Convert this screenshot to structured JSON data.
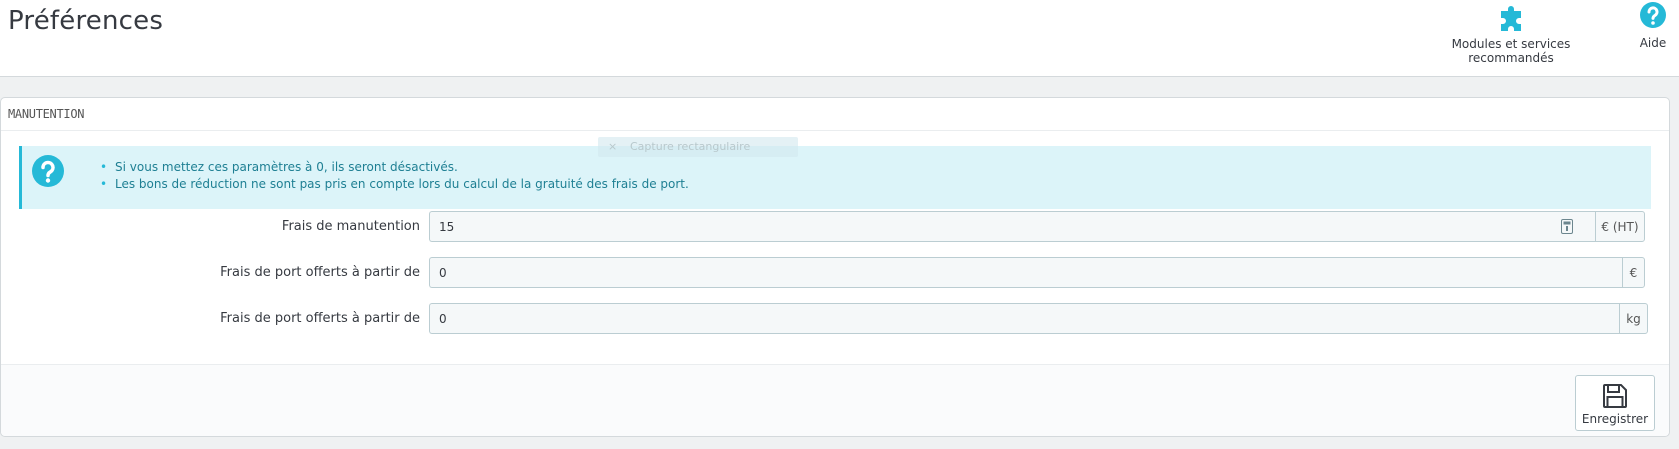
{
  "header": {
    "title": "Préférences",
    "toolbar": {
      "modules_label": "Modules et services recommandés",
      "modules_icon": "puzzle-icon",
      "help_label": "Aide",
      "help_icon": "question-circle-icon"
    }
  },
  "panel": {
    "heading": "MANUTENTION",
    "alert": {
      "icon": "question-circle-icon",
      "items": [
        "Si vous mettez ces paramètres à 0, ils seront désactivés.",
        "Les bons de réduction ne sont pas pris en compte lors du calcul de la gratuité des frais de port."
      ]
    },
    "ghost_overlay": "Capture rectangulaire",
    "fields": [
      {
        "label": "Frais de manutention",
        "value": "15",
        "addon": "€ (HT)"
      },
      {
        "label": "Frais de port offerts à partir de",
        "value": "0",
        "addon": "€"
      },
      {
        "label": "Frais de port offerts à partir de",
        "value": "0",
        "addon": "kg"
      }
    ],
    "footer": {
      "save_label": "Enregistrer",
      "save_icon": "floppy-disk-icon"
    }
  },
  "colors": {
    "accent": "#25b9d7",
    "alert_bg": "#dcf4f9",
    "alert_text": "#1e7f93",
    "input_bg": "#f5f8f9",
    "border": "#bbcdd2"
  }
}
